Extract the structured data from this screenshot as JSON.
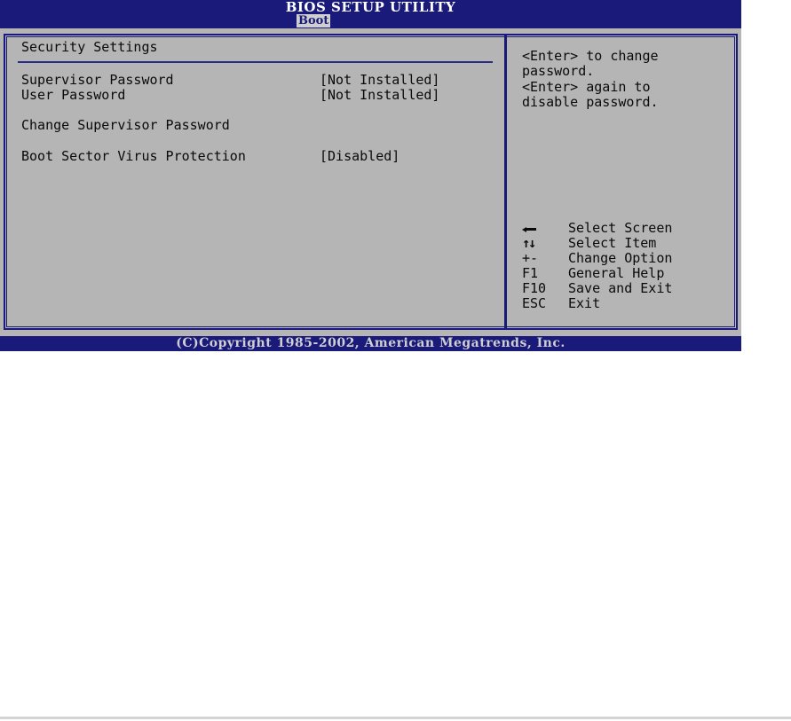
{
  "header": {
    "title": "BIOS SETUP UTILITY",
    "active_menu": "Boot"
  },
  "main": {
    "section_title": "Security Settings",
    "items": [
      {
        "label": "Supervisor Password",
        "value": "[Not Installed]"
      },
      {
        "label": "User Password",
        "value": "[Not Installed]"
      },
      {
        "label": "Change Supervisor Password",
        "value": ""
      },
      {
        "label": "Boot Sector Virus Protection",
        "value": "[Disabled]"
      }
    ]
  },
  "help": {
    "lines": [
      "<Enter> to change",
      "password.",
      "<Enter> again to",
      "disable password."
    ]
  },
  "keys": [
    {
      "key": "",
      "icon": "left-right-arrow-icon",
      "desc": "Select Screen"
    },
    {
      "key": "↑↓",
      "icon": "up-down-arrow-icon",
      "desc": "Select Item"
    },
    {
      "key": "+-",
      "desc": "Change Option"
    },
    {
      "key": "F1",
      "desc": "General Help"
    },
    {
      "key": "F10",
      "desc": "Save and Exit"
    },
    {
      "key": "ESC",
      "desc": "Exit"
    }
  ],
  "footer": {
    "copyright": "(C)Copyright 1985-2002, American Megatrends, Inc."
  },
  "colors": {
    "frame_blue": "#1a1a7a",
    "panel_gray": "#b5b5b5",
    "text": "#0a0a0a"
  }
}
